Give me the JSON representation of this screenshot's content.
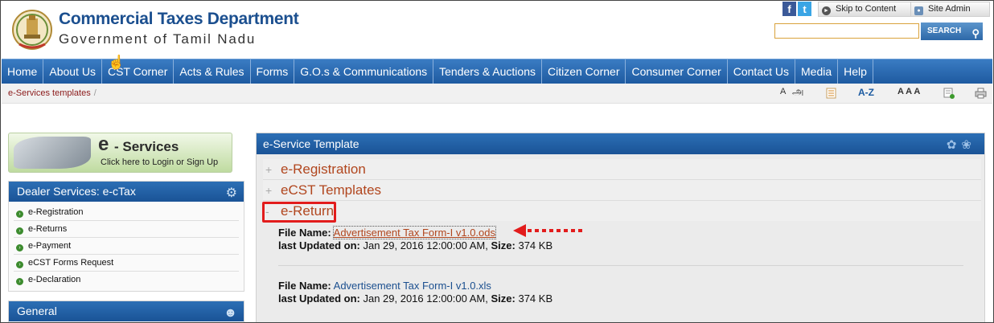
{
  "header": {
    "dept_title": "Commercial Taxes Department",
    "gov_title": "Government of Tamil Nadu",
    "facebook_glyph": "f",
    "twitter_glyph": "t",
    "skip_label": "Skip to Content",
    "admin_label": "Site Admin",
    "search_placeholder": "",
    "search_button": "SEARCH"
  },
  "nav": {
    "items": [
      "Home",
      "About Us",
      "CST Corner",
      "Acts & Rules",
      "Forms",
      "G.O.s & Communications",
      "Tenders & Auctions",
      "Citizen Corner",
      "Consumer Corner",
      "Contact Us",
      "Media",
      "Help"
    ]
  },
  "breadcrumb": {
    "current": "e-Services templates",
    "sep": "/"
  },
  "toolbar": {
    "lang_en": "A",
    "lang_ta": "அ",
    "az": "A-Z",
    "text_size": "A A A"
  },
  "banner": {
    "e": "e",
    "title": "- Services",
    "subtitle": "Click here to Login or Sign Up"
  },
  "dealer_panel": {
    "title": "Dealer Services: e-cTax",
    "items": [
      "e-Registration",
      "e-Returns",
      "e-Payment",
      "eCST Forms Request",
      "e-Declaration"
    ]
  },
  "general_panel": {
    "title": "General"
  },
  "main": {
    "title": "e-Service Template",
    "sections": [
      {
        "sign": "+",
        "label": "e-Registration"
      },
      {
        "sign": "+",
        "label": "eCST Templates"
      },
      {
        "sign": "-",
        "label": "e-Return"
      }
    ],
    "file_label": "File Name:",
    "updated_label": "last Updated on:",
    "size_label": "Size:",
    "files": [
      {
        "name": "Advertisement Tax Form-I v1.0.ods",
        "updated": "Jan 29, 2016 12:00:00 AM,",
        "size": "374 KB"
      },
      {
        "name": "Advertisement Tax Form-I v1.0.xls",
        "updated": "Jan 29, 2016 12:00:00 AM,",
        "size": "374 KB"
      }
    ]
  },
  "colors": {
    "nav_blue": "#2a6cb3",
    "link_orange": "#b1461e",
    "highlight_red": "#e21c1c"
  },
  "icons": {
    "logo": "state-emblem-icon",
    "cursor": "hand-pointer-icon",
    "arrow": "dotted-arrow-left-icon"
  }
}
